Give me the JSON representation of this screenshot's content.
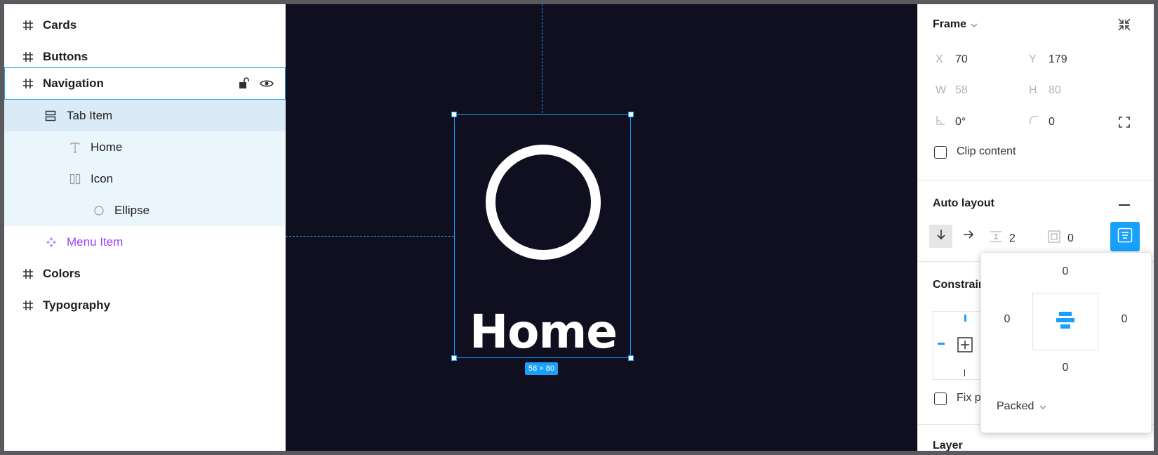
{
  "layers": [
    {
      "label": "Cards",
      "icon": "hash-icon",
      "style": "bold"
    },
    {
      "label": "Buttons",
      "icon": "hash-icon",
      "style": "bold"
    },
    {
      "label": "Navigation",
      "icon": "hash-icon",
      "style": "bold"
    },
    {
      "label": "Tab Item",
      "icon": "autolayout-vertical-icon",
      "style": "normal"
    },
    {
      "label": "Home",
      "icon": "text-icon",
      "style": "normal"
    },
    {
      "label": "Icon",
      "icon": "columns-icon",
      "style": "normal"
    },
    {
      "label": "Ellipse",
      "icon": "ellipse-icon",
      "style": "normal"
    },
    {
      "label": "Menu Item",
      "icon": "component-icon",
      "style": "component"
    },
    {
      "label": "Colors",
      "icon": "hash-icon",
      "style": "bold"
    },
    {
      "label": "Typography",
      "icon": "hash-icon",
      "style": "bold"
    }
  ],
  "canvas": {
    "frame_text": "Home",
    "size_badge": "58 × 80"
  },
  "frame": {
    "title": "Frame",
    "x_label": "X",
    "x": "70",
    "y_label": "Y",
    "y": "179",
    "w_label": "W",
    "w": "58",
    "h_label": "H",
    "h": "80",
    "rotation": "0°",
    "radius": "0",
    "clip_content": "Clip content"
  },
  "auto_layout": {
    "title": "Auto layout",
    "spacing": "2",
    "padding": "0"
  },
  "constraints": {
    "title": "Constrain",
    "fix_position": "Fix p"
  },
  "layer_section": {
    "title": "Layer"
  },
  "popover": {
    "top": "0",
    "left": "0",
    "right": "0",
    "bottom": "0",
    "distribution": "Packed"
  },
  "colors": {
    "accent": "#18a0fb",
    "canvas_bg": "#0f0f20",
    "component": "#9747ff",
    "selected_row": "#daebf7",
    "child_row": "#ebf5fc"
  }
}
